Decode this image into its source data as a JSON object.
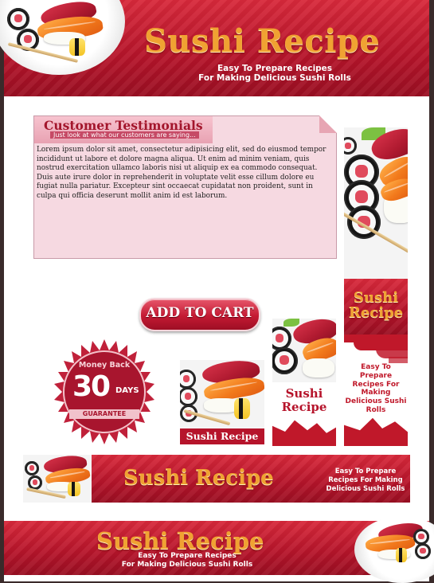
{
  "colors": {
    "brand_red": "#c0182a",
    "gold": "#f0a232",
    "pink_panel": "#f6d9e1"
  },
  "header": {
    "title": "Sushi Recipe",
    "subtitle_line1": "Easy To Prepare Recipes",
    "subtitle_line2": "For Making Delicious Sushi Rolls"
  },
  "testimonials": {
    "title": "Customer Testimonials",
    "subtitle": "Just look at what our customers are saying...",
    "body": "Lorem ipsum dolor sit amet, consectetur adipisicing elit, sed do eiusmod tempor incididunt ut labore et dolore magna aliqua. Ut enim ad minim veniam, quis nostrud exercitation ullamco laboris nisi ut aliquip ex ea commodo consequat. Duis aute irure dolor in reprehenderit in voluptate velit esse cillum dolore eu fugiat nulla pariatur. Excepteur sint occaecat cupidatat non proident, sunt in culpa qui officia deserunt mollit anim id est laborum."
  },
  "add_to_cart": {
    "label": "ADD TO CART"
  },
  "badge": {
    "top": "Money Back",
    "number": "30",
    "unit": "DAYS",
    "bottom": "GUARANTEE"
  },
  "square_banner": {
    "label": "Sushi Recipe"
  },
  "mid_banner": {
    "title": "Sushi Recipe"
  },
  "tall_banner": {
    "title": "Sushi Recipe",
    "text": "Easy To Prepare Recipes For Making Delicious Sushi Rolls"
  },
  "wide_banner": {
    "title": "Sushi Recipe",
    "text": "Easy To Prepare Recipes For Making Delicious Sushi Rolls"
  },
  "bottom_banner": {
    "title": "Sushi Recipe",
    "subtitle_line1": "Easy To Prepare Recipes",
    "subtitle_line2": "For Making Delicious Sushi Rolls"
  }
}
